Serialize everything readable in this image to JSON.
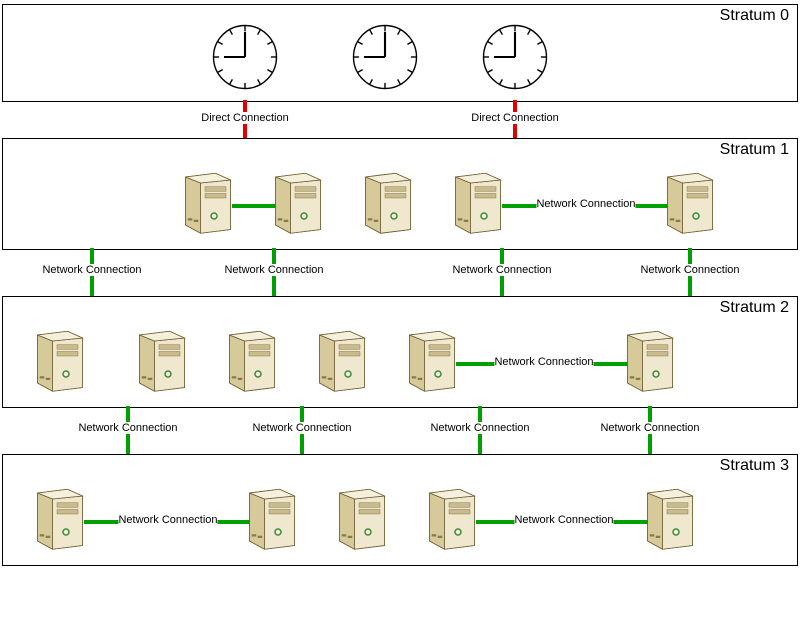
{
  "strata": {
    "s0": "Stratum 0",
    "s1": "Stratum 1",
    "s2": "Stratum 2",
    "s3": "Stratum 3"
  },
  "labels": {
    "direct": "Direct Connection",
    "network": "Network Connection"
  }
}
